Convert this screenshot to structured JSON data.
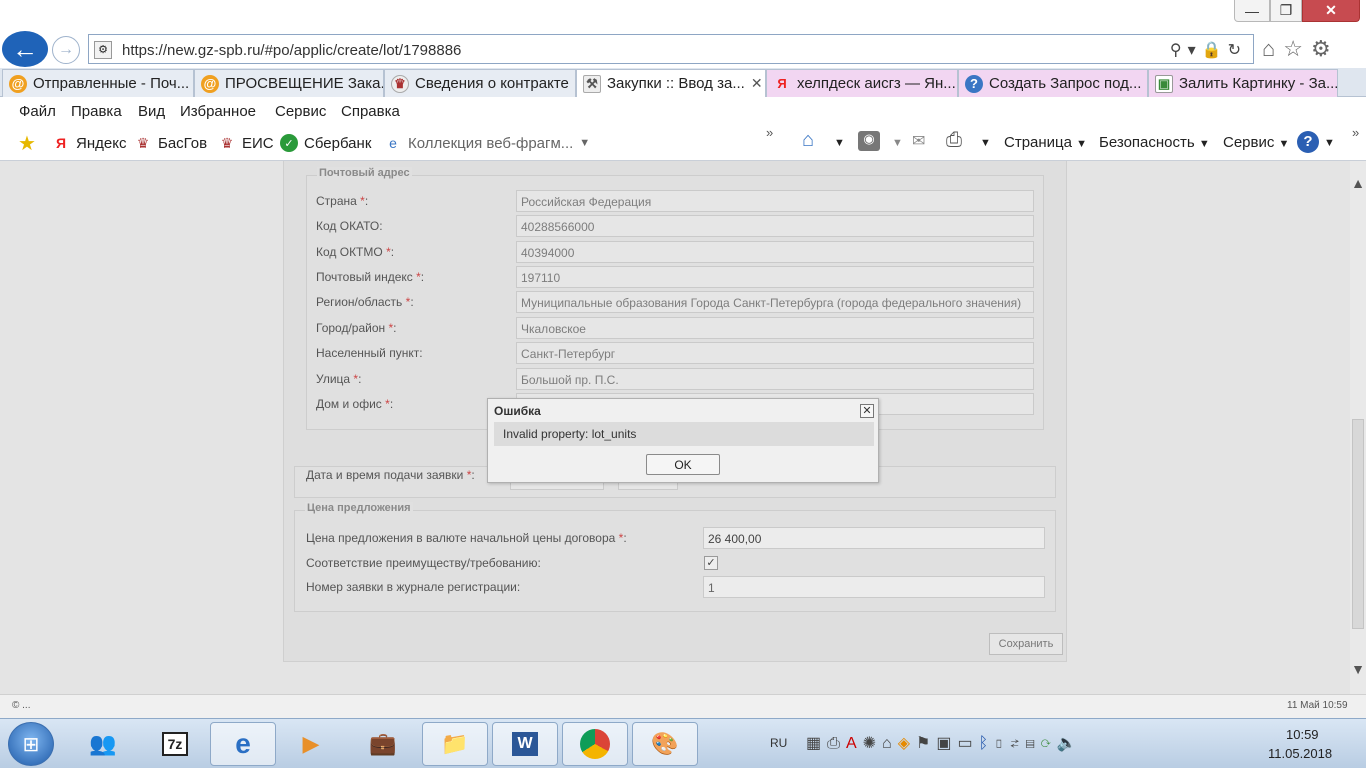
{
  "browser": {
    "url": "https://new.gz-spb.ru/#po/applic/create/lot/1798886",
    "tabs": [
      {
        "label": "Отправленные - Поч..."
      },
      {
        "label": "ПРОСВЕЩЕНИЕ Зака..."
      },
      {
        "label": "Сведения о контракте"
      },
      {
        "label": "Закупки :: Ввод за..."
      },
      {
        "label": "хелпдеск аисгз — Ян..."
      },
      {
        "label": "Создать Запрос под..."
      },
      {
        "label": "Залить Картинку - За..."
      }
    ],
    "menu": [
      "Файл",
      "Правка",
      "Вид",
      "Избранное",
      "Сервис",
      "Справка"
    ],
    "favorites": [
      "Яндекс",
      "БасГов",
      "ЕИС",
      "Сбербанк",
      "Коллекция веб-фрагм..."
    ],
    "commands": [
      "Страница",
      "Безопасность",
      "Сервис"
    ]
  },
  "form": {
    "postal": {
      "legend": "Почтовый адрес",
      "rows": [
        {
          "label": "Страна",
          "required": true,
          "value": "Российская Федерация"
        },
        {
          "label": "Код ОКАТО:",
          "required": false,
          "value": "40288566000"
        },
        {
          "label": "Код ОКТМО",
          "required": true,
          "value": "40394000"
        },
        {
          "label": "Почтовый индекс",
          "required": true,
          "value": "197110"
        },
        {
          "label": "Регион/область",
          "required": true,
          "value": "Муниципальные образования Города Санкт-Петербурга (города федерального значения)"
        },
        {
          "label": "Город/район",
          "required": true,
          "value": "Чкаловское"
        },
        {
          "label": "Населенный пункт:",
          "required": false,
          "value": "Санкт-Петербург"
        },
        {
          "label": "Улица",
          "required": true,
          "value": "Большой пр. П.С."
        },
        {
          "label": "Дом и офис",
          "required": true,
          "value": ""
        }
      ]
    },
    "submit_date_label": "Дата и время подачи заявки",
    "price": {
      "legend": "Цена предложения",
      "price_label": "Цена предложения в валюте начальной цены договора",
      "price_value": "26 400,00",
      "advantage_label": "Соответствие преимуществу/требованию:",
      "advantage_checked": true,
      "regnum_label": "Номер заявки в журнале регистрации:",
      "regnum_value": "1"
    },
    "save_label": "Сохранить"
  },
  "dialog": {
    "title": "Ошибка",
    "message": "Invalid property: lot_units",
    "ok_label": "OK"
  },
  "statusbar": {
    "left": "© ...",
    "right": "11 Май 10:59"
  },
  "taskbar": {
    "lang": "RU",
    "time": "10:59",
    "date": "11.05.2018"
  }
}
